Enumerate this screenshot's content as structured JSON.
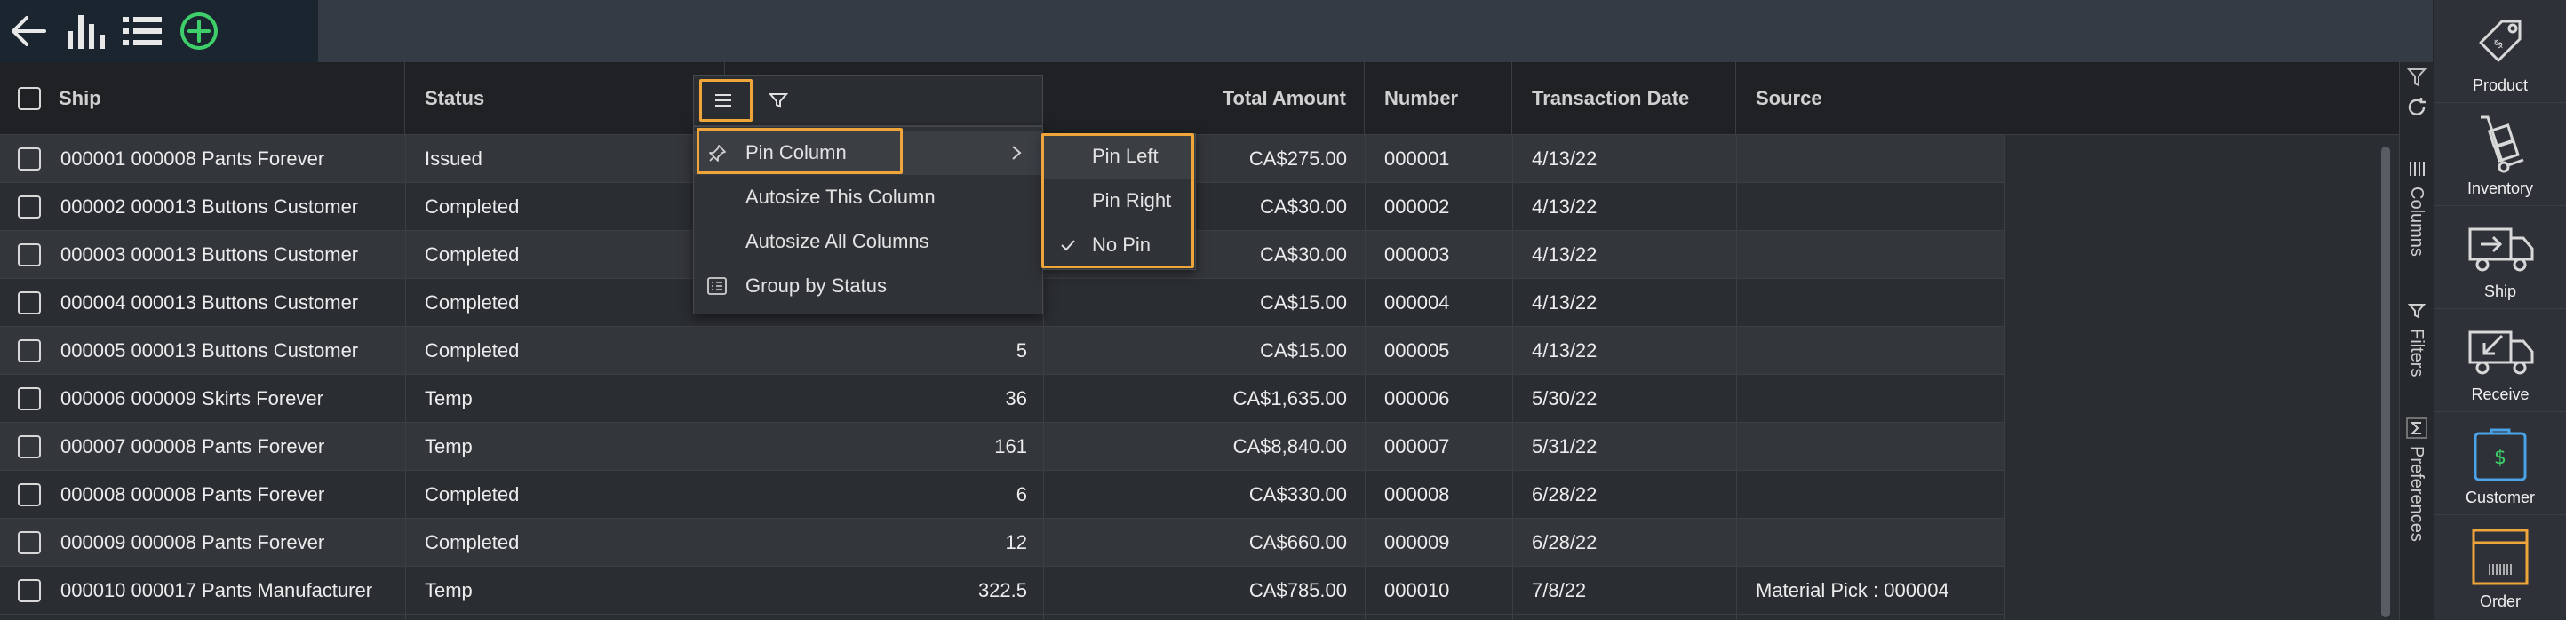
{
  "toolbar": {
    "icons": [
      "back-arrow-icon",
      "bar-chart-icon",
      "list-icon",
      "add-circle-icon"
    ],
    "add_color": "#3ecf6a"
  },
  "columns": {
    "ship": "Ship",
    "status": "Status",
    "total_amount": "Total Amount",
    "number": "Number",
    "transaction_date": "Transaction Date",
    "source": "Source"
  },
  "rows": [
    {
      "ship": "000001 000008 Pants Forever",
      "status": "Issued",
      "qty": "",
      "total": "CA$275.00",
      "number": "000001",
      "date": "4/13/22",
      "source": ""
    },
    {
      "ship": "000002 000013 Buttons Customer",
      "status": "Completed",
      "qty": "",
      "total": "CA$30.00",
      "number": "000002",
      "date": "4/13/22",
      "source": ""
    },
    {
      "ship": "000003 000013 Buttons Customer",
      "status": "Completed",
      "qty": "",
      "total": "CA$30.00",
      "number": "000003",
      "date": "4/13/22",
      "source": ""
    },
    {
      "ship": "000004 000013 Buttons Customer",
      "status": "Completed",
      "qty": "",
      "total": "CA$15.00",
      "number": "000004",
      "date": "4/13/22",
      "source": ""
    },
    {
      "ship": "000005 000013 Buttons Customer",
      "status": "Completed",
      "qty": "5",
      "total": "CA$15.00",
      "number": "000005",
      "date": "4/13/22",
      "source": ""
    },
    {
      "ship": "000006 000009 Skirts Forever",
      "status": "Temp",
      "qty": "36",
      "total": "CA$1,635.00",
      "number": "000006",
      "date": "5/30/22",
      "source": ""
    },
    {
      "ship": "000007 000008 Pants Forever",
      "status": "Temp",
      "qty": "161",
      "total": "CA$8,840.00",
      "number": "000007",
      "date": "5/31/22",
      "source": ""
    },
    {
      "ship": "000008 000008 Pants Forever",
      "status": "Completed",
      "qty": "6",
      "total": "CA$330.00",
      "number": "000008",
      "date": "6/28/22",
      "source": ""
    },
    {
      "ship": "000009 000008 Pants Forever",
      "status": "Completed",
      "qty": "12",
      "total": "CA$660.00",
      "number": "000009",
      "date": "6/28/22",
      "source": ""
    },
    {
      "ship": "000010 000017 Pants Manufacturer",
      "status": "Temp",
      "qty": "322.5",
      "total": "CA$785.00",
      "number": "000010",
      "date": "7/8/22",
      "source": "Material Pick : 000004"
    }
  ],
  "column_menu": {
    "items": [
      "Pin Column",
      "Autosize This Column",
      "Autosize All Columns",
      "Group by Status"
    ],
    "pin_submenu": [
      "Pin Left",
      "Pin Right",
      "No Pin"
    ],
    "checked": "No Pin",
    "highlight_color": "#f0a53a"
  },
  "side_panel": {
    "tabs": [
      "Columns",
      "Filters",
      "Preferences"
    ]
  },
  "right_nav": {
    "items": [
      "Product",
      "Inventory",
      "Ship",
      "Receive",
      "Customer",
      "Order"
    ]
  }
}
